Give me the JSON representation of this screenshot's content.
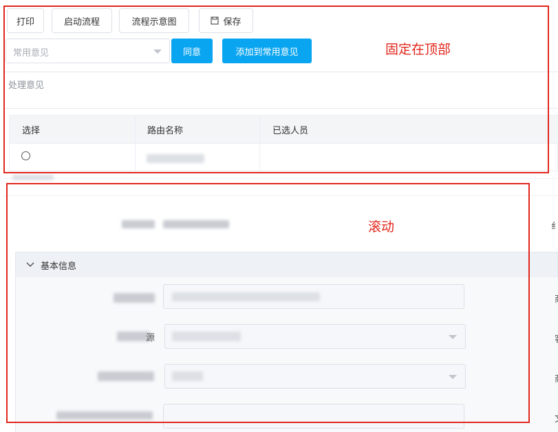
{
  "toolbar": {
    "print_label": "打印",
    "start_flow_label": "启动流程",
    "flow_diagram_label": "流程示意图",
    "save_label": "保存"
  },
  "opinion": {
    "placeholder": "常用意见",
    "agree_label": "同意",
    "add_common_label": "添加到常用意见",
    "process_label": "处理意见"
  },
  "route_table": {
    "headers": [
      "选择",
      "路由名称",
      "已选人员"
    ],
    "rows": [
      {
        "select": "○",
        "route_name": "",
        "selected_people": ""
      }
    ]
  },
  "annotations": {
    "fixed_top": "固定在顶部",
    "scroll": "滚动",
    "color": "#e1251b"
  },
  "section": {
    "basic_info_label": "基本信息",
    "field2_label_fragment": "源"
  },
  "right_edge": [
    "纟",
    "商",
    "客",
    "商",
    "文"
  ],
  "colors": {
    "primary": "#0aa5f0",
    "annotation_red": "#e1251b"
  }
}
